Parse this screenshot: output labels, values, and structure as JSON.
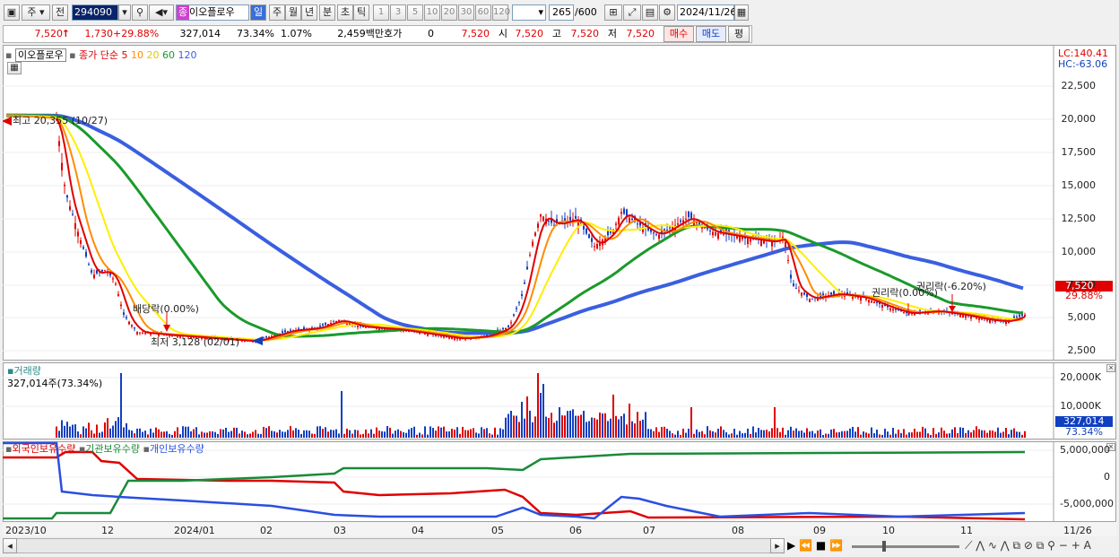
{
  "toolbar": {
    "period_label": "주",
    "jeon_label": "전",
    "code_value": "294090",
    "stock_name": "이오플로우",
    "timeframes": [
      "일",
      "주",
      "월",
      "년",
      "분",
      "초",
      "틱"
    ],
    "intervals": [
      "1",
      "3",
      "5",
      "10",
      "20",
      "30",
      "60",
      "120"
    ],
    "count_value": "265",
    "count_total": "/600",
    "date_value": "2024/11/26"
  },
  "quote": {
    "price": "7,520",
    "arrow": "↑",
    "change": "1,730",
    "change_pct": "+29.88%",
    "volume": "327,014",
    "volume_ratio": "73.34%",
    "turnover": "1.07%",
    "amount": "2,459백만",
    "hoga_label": "호가",
    "hoga_value": "0",
    "ask_price": "7,520",
    "open_label": "시",
    "open_value": "7,520",
    "high_label": "고",
    "high_value": "7,520",
    "low_label": "저",
    "low_value": "7,520",
    "buy_label": "매수",
    "sell_label": "매도",
    "eval_label": "평"
  },
  "price_panel": {
    "legend_name": "이오플로우",
    "ma_label": "종가 단순",
    "ma_periods": [
      "5",
      "10",
      "20",
      "60",
      "120"
    ],
    "ma_colors": [
      "#e00000",
      "#ff8c00",
      "#ffee00",
      "#1a9a2a",
      "#3a5fe0"
    ],
    "lc": "LC:140.41",
    "hc": "HC:-63.06",
    "y_ticks": [
      "22,500",
      "20,000",
      "17,500",
      "15,000",
      "12,500",
      "10,000",
      "7,500",
      "5,000",
      "2,500"
    ],
    "current_price_tag": "7,520",
    "current_pct_tag": "29.88%",
    "annotations": {
      "high": "최고 20,355 (10/27)",
      "low": "최저 3,128 (02/01)",
      "dividend": "배당락(0.00%)",
      "rights1": "권리락(0.00%)",
      "rights2": "권리락(-6.20%)"
    }
  },
  "volume_panel": {
    "title": "거래량",
    "value_text": "327,014주(73.34%)",
    "y_ticks": [
      "20,000K",
      "10,000K"
    ],
    "tag_value": "327,014",
    "tag_pct": "73.34%"
  },
  "holdings_panel": {
    "legend": [
      "외국인보유수량",
      "기관보유수량",
      "개인보유수량"
    ],
    "colors": [
      "#e00000",
      "#1a8a3a",
      "#2a4fe0"
    ],
    "y_ticks": [
      "5,000,000",
      "0",
      "-5,000,000"
    ]
  },
  "x_axis": {
    "labels": [
      "2023/10",
      "12",
      "2024/01",
      "02",
      "03",
      "04",
      "05",
      "06",
      "07",
      "08",
      "09",
      "10",
      "11",
      "11/26"
    ]
  },
  "colors": {
    "up": "#e00000",
    "down": "#1040c0",
    "tag_bg": "#e00000"
  }
}
